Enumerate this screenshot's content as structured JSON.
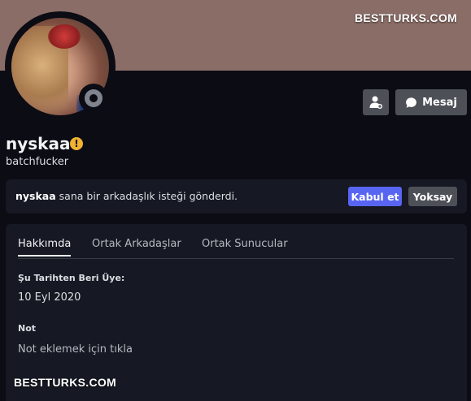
{
  "watermark": "BESTTURKS.COM",
  "profile": {
    "username": "nyskaa",
    "tag": "batchfucker",
    "status": "offline",
    "warning_badge": "!"
  },
  "actions": {
    "message_label": "Mesaj"
  },
  "friend_request": {
    "name": "nyskaa",
    "text": "sana bir arkadaşlık isteği gönderdi.",
    "accept_label": "Kabul et",
    "ignore_label": "Yoksay"
  },
  "tabs": [
    {
      "label": "Hakkımda",
      "active": true
    },
    {
      "label": "Ortak Arkadaşlar",
      "active": false
    },
    {
      "label": "Ortak Sunucular",
      "active": false
    }
  ],
  "about": {
    "member_since_title": "Şu Tarihten Beri Üye:",
    "member_since_value": "10 Eyl 2020",
    "note_title": "Not",
    "note_placeholder": "Not eklemek için tıkla"
  },
  "colors": {
    "banner": "#8a6d66",
    "accept": "#5865f2",
    "secondary_button": "#4e5058",
    "status_offline": "#80848e",
    "warning": "#f0b232"
  },
  "icons": [
    "add-friend-icon",
    "message-bubble-icon",
    "warning-icon",
    "status-offline-icon"
  ]
}
